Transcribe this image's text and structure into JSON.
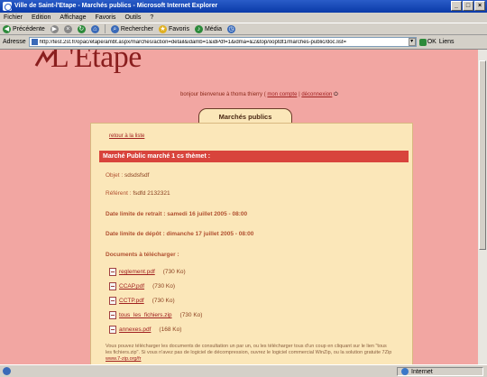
{
  "window": {
    "title": "Ville de Saint-l'Etape - Marchés publics - Microsoft Internet Explorer",
    "controls": [
      "_",
      "□",
      "×"
    ]
  },
  "menu": [
    "Fichier",
    "Edition",
    "Affichage",
    "Favoris",
    "Outils",
    "?"
  ],
  "toolbar": {
    "back": "Précédente",
    "forward": "",
    "search": "Rechercher",
    "favorites": "Favoris",
    "media": "Média"
  },
  "address": {
    "label": "Adresse",
    "url": "http://test.2st.fr/opac/etape/ambt.aspx/marches/action=detail&idamb=1&idPdf=1&idma=&2&top/ooptdt1/marches-public/doc.list=",
    "go": "OK",
    "links": "Liens"
  },
  "site": {
    "logo": "L'Etape",
    "user_text": "bonjour bienvenue à thoma thierry (",
    "account_link": "mon compte",
    "sep": "|",
    "logout_link": "déconnexion",
    "tab": "Marchés publics"
  },
  "market": {
    "back_link": "retour à la liste",
    "header": "Marché Public marché 1 cs thèmet :",
    "object_label": "Objet :",
    "object_value": "sdsdsfsdf",
    "ref_label": "Référent :",
    "ref_value": "fsdfd 2132321",
    "withdrawal": "Date limite de retrait : samedi 16 juillet 2005 - 08:00",
    "deposit": "Date limite de dépôt : dimanche 17 juillet 2005 - 08:00",
    "docs_title": "Documents à télécharger :",
    "documents": [
      {
        "name": "reglement.pdf",
        "size": "(730 Ko)"
      },
      {
        "name": "CCAP.pdf",
        "size": "(730 Ko)"
      },
      {
        "name": "CCTP.pdf",
        "size": "(730 Ko)"
      },
      {
        "name": "tous_les_fichiers.zip",
        "size": "(730 Ko)"
      },
      {
        "name": "annexes.pdf",
        "size": "(168 Ko)"
      }
    ],
    "note": "Vous pouvez télécharger les documents de consultation un par un, ou les télécharger tous d'un coup en cliquant sur le lien \"tous les fichiers.zip\". Si vous n'avez pas de logiciel de décompression, ouvrez le logiciel commercial WinZip, ou la solution gratuite 7Zip",
    "note_link": "www.7-zip.org/fr"
  },
  "status": {
    "zone": "Internet"
  }
}
